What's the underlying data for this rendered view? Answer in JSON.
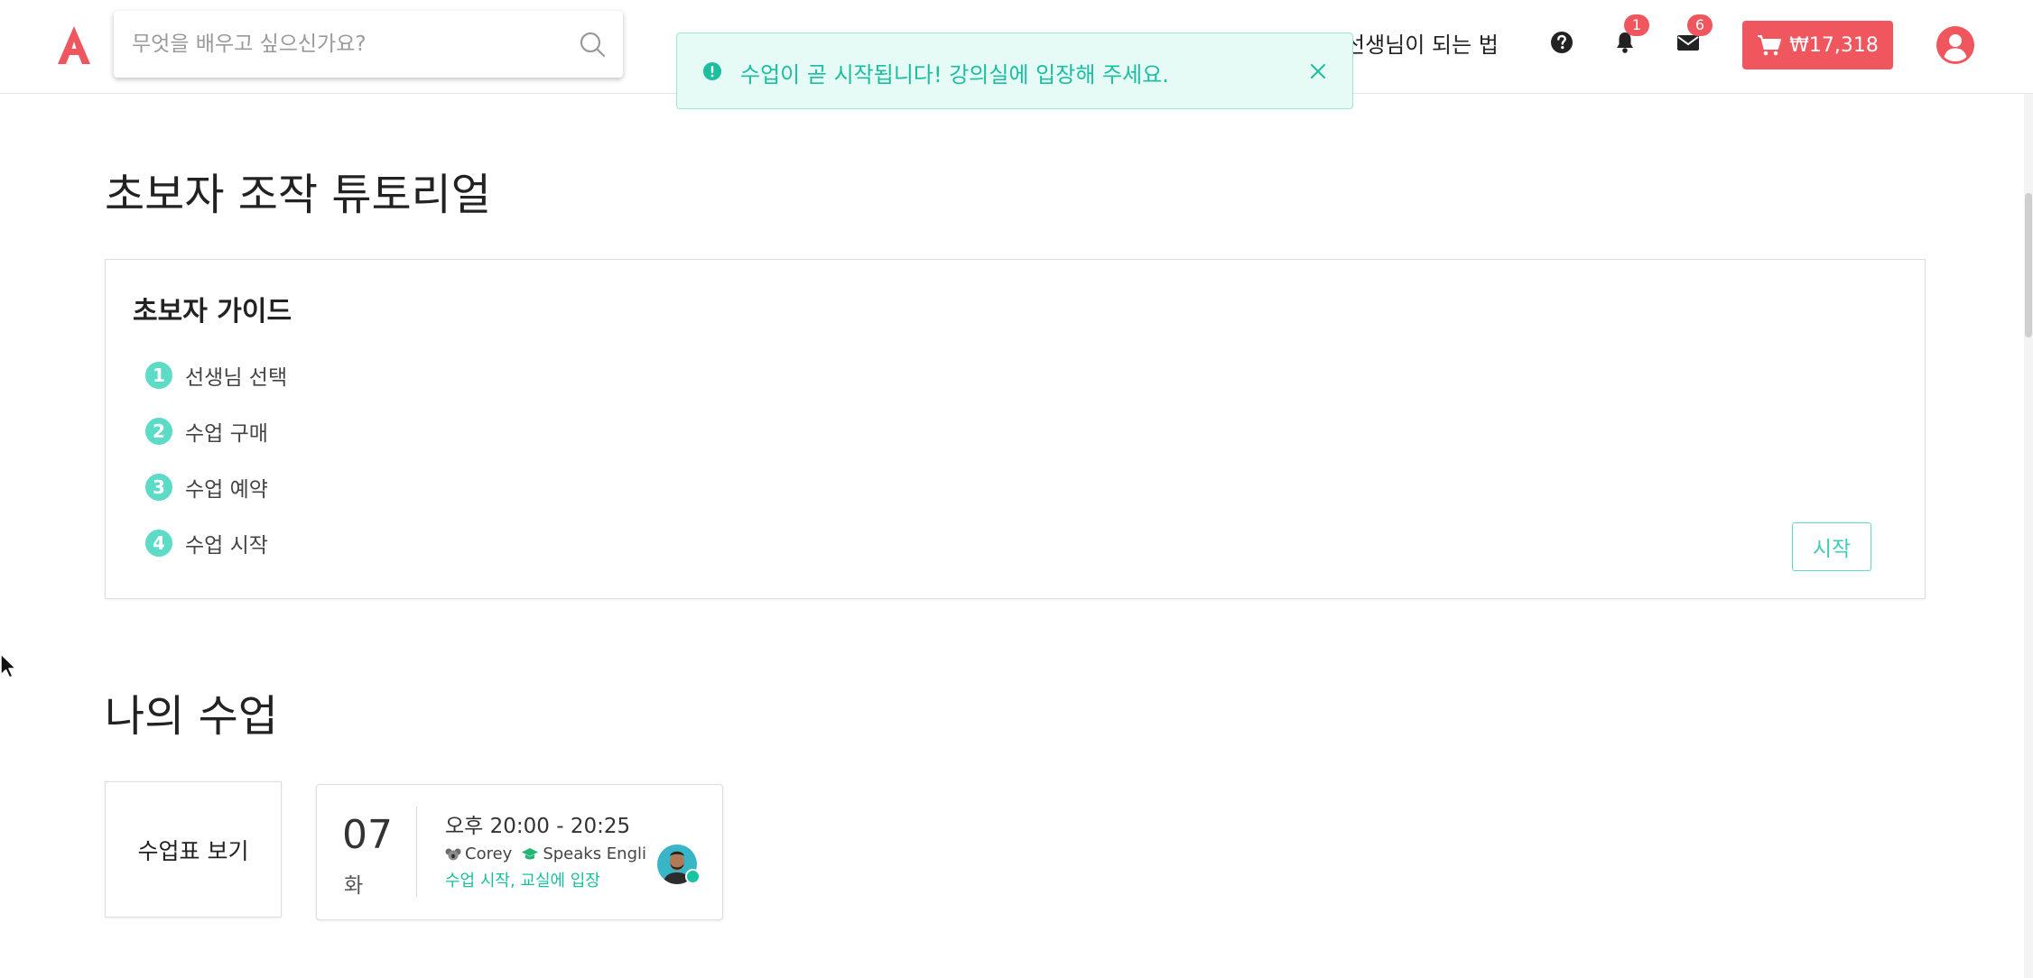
{
  "header": {
    "logo_letter": "A",
    "search": {
      "placeholder": "무엇을 배우고 싶으신가요?",
      "value": ""
    },
    "teacher_link": "선생님이 되는 법",
    "notification_count": "1",
    "message_count": "6",
    "cart_amount": "₩17,318",
    "brand_color": "#f0565d"
  },
  "toast": {
    "message": "수업이 곧 시작됩니다! 강의실에 입장해 주세요.",
    "color": "#1bbfa0"
  },
  "tutorial": {
    "title": "초보자 조작 튜토리얼",
    "guide_title": "초보자 가이드",
    "steps": [
      {
        "num": "1",
        "label": "선생님 선택"
      },
      {
        "num": "2",
        "label": "수업 구매"
      },
      {
        "num": "3",
        "label": "수업 예약"
      },
      {
        "num": "4",
        "label": "수업 시작"
      }
    ],
    "start_label": "시작",
    "accent_color": "#5cdbc7"
  },
  "my_lessons": {
    "title": "나의 수업",
    "schedule_label": "수업표 보기",
    "lesson": {
      "day": "07",
      "weekday": "화",
      "time": "오후 20:00 - 20:25",
      "teacher": "Corey",
      "language": "Speaks Engli...",
      "action": "수업 시작, 교실에 입장"
    }
  }
}
